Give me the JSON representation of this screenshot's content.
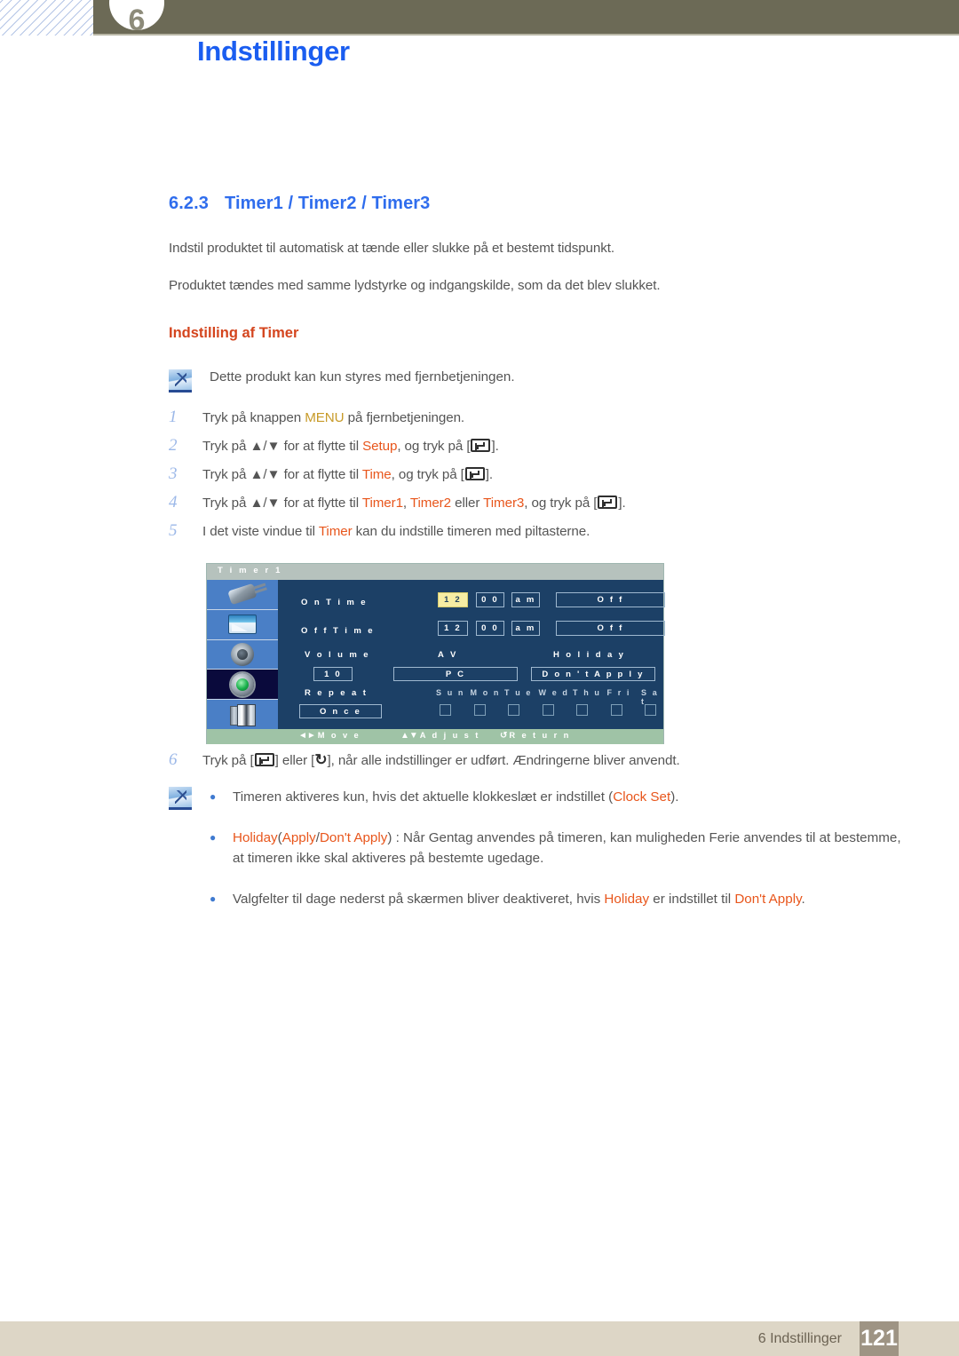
{
  "header": {
    "chapter_number": "6",
    "title": "Indstillinger"
  },
  "section": {
    "number": "6.2.3",
    "title": "Timer1 / Timer2 / Timer3",
    "paragraph_1": "Indstil produktet til automatisk at tænde eller slukke på et bestemt tidspunkt.",
    "paragraph_2": "Produktet tændes med samme lydstyrke og indgangskilde, som da det blev slukket.",
    "sub_heading": "Indstilling af Timer"
  },
  "note_top": {
    "icon": "note-pencil-icon",
    "text": "Dette produkt kan kun styres med fjernbetjeningen."
  },
  "steps": [
    {
      "num": "1",
      "parts": [
        {
          "t": "Tryk på knappen ",
          "c": "plain"
        },
        {
          "t": "MENU",
          "c": "tan"
        },
        {
          "t": " på fjernbetjeningen.",
          "c": "plain"
        }
      ]
    },
    {
      "num": "2",
      "parts": [
        {
          "t": "Tryk på ▲/▼ for at flytte til ",
          "c": "plain"
        },
        {
          "t": "Setup",
          "c": "orange"
        },
        {
          "t": ", og tryk på [",
          "c": "plain"
        },
        {
          "t": "KEY_ENTER",
          "c": "glyph"
        },
        {
          "t": "].",
          "c": "plain"
        }
      ]
    },
    {
      "num": "3",
      "parts": [
        {
          "t": "Tryk på ▲/▼ for at flytte til ",
          "c": "plain"
        },
        {
          "t": "Time",
          "c": "orange"
        },
        {
          "t": ", og tryk på [",
          "c": "plain"
        },
        {
          "t": "KEY_ENTER",
          "c": "glyph"
        },
        {
          "t": "].",
          "c": "plain"
        }
      ]
    },
    {
      "num": "4",
      "parts": [
        {
          "t": "Tryk på ▲/▼ for at flytte til ",
          "c": "plain"
        },
        {
          "t": "Timer1",
          "c": "orange"
        },
        {
          "t": ", ",
          "c": "plain"
        },
        {
          "t": "Timer2",
          "c": "orange"
        },
        {
          "t": " eller ",
          "c": "plain"
        },
        {
          "t": "Timer3",
          "c": "orange"
        },
        {
          "t": ", og tryk på [",
          "c": "plain"
        },
        {
          "t": "KEY_ENTER",
          "c": "glyph"
        },
        {
          "t": "].",
          "c": "plain"
        }
      ]
    },
    {
      "num": "5",
      "parts": [
        {
          "t": "I det viste vindue til ",
          "c": "plain"
        },
        {
          "t": "Timer",
          "c": "orange"
        },
        {
          "t": " kan du indstille timeren med piltasterne.",
          "c": "plain"
        }
      ]
    },
    {
      "num": "6",
      "parts": [
        {
          "t": "Tryk på [",
          "c": "plain"
        },
        {
          "t": "KEY_ENTER",
          "c": "glyph"
        },
        {
          "t": "] eller [",
          "c": "plain"
        },
        {
          "t": "KEY_RETURN",
          "c": "retglyph"
        },
        {
          "t": "], når alle indstillinger er udført. Ændringerne bliver anvendt.",
          "c": "plain"
        }
      ]
    }
  ],
  "osd": {
    "title": "T i m e r 1",
    "sidebar_icons": [
      {
        "name": "input-plug-icon",
        "selected": false
      },
      {
        "name": "picture-screen-icon",
        "selected": false
      },
      {
        "name": "sound-speaker-icon",
        "selected": false
      },
      {
        "name": "setup-gear-icon",
        "selected": true
      },
      {
        "name": "multi-control-stack-icon",
        "selected": false
      }
    ],
    "rows": {
      "on_time_label": "O n   T i m e",
      "on_time_hour": "1 2",
      "on_time_min": "0 0",
      "on_time_ampm": "a m",
      "on_time_state": "O f f",
      "off_time_label": "O f f   T i m e",
      "off_time_hour": "1 2",
      "off_time_min": "0 0",
      "off_time_ampm": "a m",
      "off_time_state": "O f f",
      "volume_label": "V o l u m e",
      "volume_value": "1 0",
      "av_label": "A V",
      "av_value": "P C",
      "holiday_label": "H o l i d a y",
      "holiday_value": "D o n ' t  A p p l y",
      "repeat_label": "R e p e a t",
      "repeat_value": "O n c e"
    },
    "days": [
      "S u n",
      "M o n",
      "T u e",
      "W e d",
      "T h u",
      "F r i",
      "S a t"
    ],
    "footer": {
      "move": "M o v e",
      "adjust": "A d j u s t",
      "return": "R e t u r n",
      "move_glyph": "◄►",
      "adjust_glyph": "▲▼",
      "return_glyph": "↺"
    },
    "colors": {
      "panel_bg": "#1c4066",
      "sidebar_bg": "#4a7fc6",
      "selected_bg": "#0a0a3c",
      "title_bg": "#b6c2bd",
      "footer_bg": "#9fc3a6",
      "highlight": "#f6eda4"
    }
  },
  "note_bottom": {
    "icon": "note-pencil-icon",
    "bullets": [
      [
        {
          "t": "Timeren aktiveres kun, hvis det aktuelle klokkeslæt er indstillet (",
          "c": "plain"
        },
        {
          "t": "Clock Set",
          "c": "orange"
        },
        {
          "t": ").",
          "c": "plain"
        }
      ],
      [
        {
          "t": "Holiday",
          "c": "orange"
        },
        {
          "t": "(",
          "c": "plain"
        },
        {
          "t": "Apply",
          "c": "orange"
        },
        {
          "t": "/",
          "c": "plain"
        },
        {
          "t": "Don't Apply",
          "c": "orange"
        },
        {
          "t": ") : Når Gentag anvendes på timeren, kan muligheden Ferie anvendes til at bestemme, at timeren ikke skal aktiveres på bestemte ugedage.",
          "c": "plain"
        }
      ],
      [
        {
          "t": "Valgfelter til dage nederst på skærmen bliver deaktiveret, hvis ",
          "c": "plain"
        },
        {
          "t": "Holiday",
          "c": "orange"
        },
        {
          "t": " er indstillet til ",
          "c": "plain"
        },
        {
          "t": "Don't Apply",
          "c": "orange"
        },
        {
          "t": ".",
          "c": "plain"
        }
      ]
    ]
  },
  "footer": {
    "chapter_label": "6 Indstillinger",
    "page_number": "121"
  },
  "colors": {
    "heading_blue": "#2f6ded",
    "title_blue": "#1a5df0",
    "accent_orange": "#e8561c",
    "accent_tan": "#c79a28",
    "subhead_orange": "#d4451e",
    "header_olive": "#6c6a56",
    "footer_tan": "#ddd6c6",
    "page_box": "#9e9484"
  }
}
